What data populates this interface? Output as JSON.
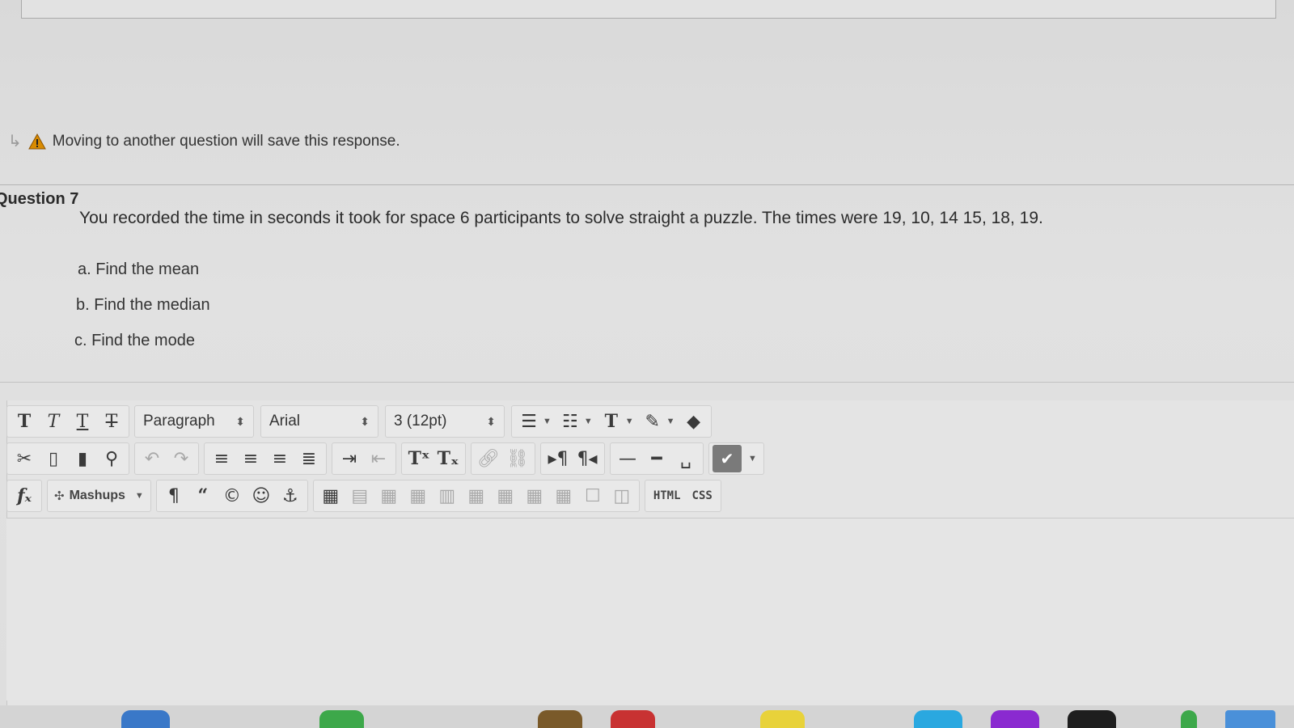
{
  "notice": {
    "text": "Moving to another question will save this response.",
    "arrow_icon": "arrow-return-icon",
    "warning_icon": "warning-icon"
  },
  "question": {
    "label": "Question 7",
    "text": "You recorded the time in seconds it took for space 6 participants to solve straight a puzzle. The times were 19, 10, 14 15, 18, 19.",
    "parts": [
      "a. Find the mean",
      "b. Find the median",
      "c. Find the mode"
    ]
  },
  "toolbar": {
    "format_select": "Paragraph",
    "font_select": "Arial",
    "size_select": "3 (12pt)",
    "mashups": "Mashups",
    "html": "HTML",
    "css": "CSS",
    "accent": "#7a7a7a"
  }
}
